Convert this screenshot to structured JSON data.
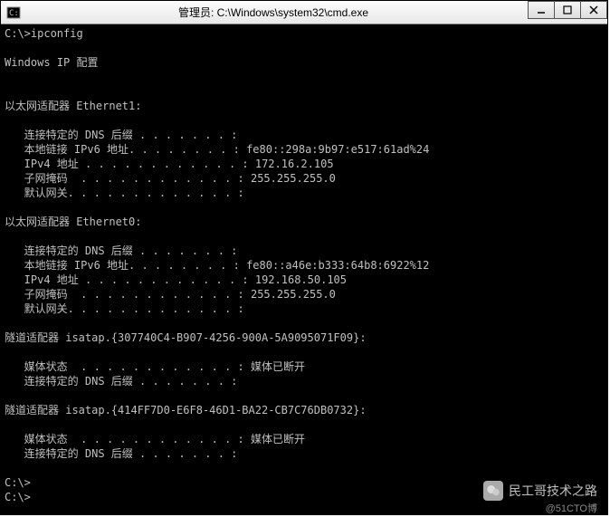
{
  "window": {
    "title": "管理员: C:\\Windows\\system32\\cmd.exe"
  },
  "prompt": "C:\\>",
  "command": "ipconfig",
  "header": "Windows IP 配置",
  "adapters": [
    {
      "title": "以太网适配器 Ethernet1:",
      "rows": [
        {
          "label": "连接特定的 DNS 后缀",
          "dots": " . . . . . . . ",
          "value": ""
        },
        {
          "label": "本地链接 IPv6 地址",
          "dots": ". . . . . . . . ",
          "value": "fe80::298a:9b97:e517:61ad%24"
        },
        {
          "label": "IPv4 地址",
          "dots": " . . . . . . . . . . . . ",
          "value": "172.16.2.105"
        },
        {
          "label": "子网掩码",
          "dots": "  . . . . . . . . . . . . ",
          "value": "255.255.255.0"
        },
        {
          "label": "默认网关",
          "dots": ". . . . . . . . . . . . . ",
          "value": ""
        }
      ]
    },
    {
      "title": "以太网适配器 Ethernet0:",
      "rows": [
        {
          "label": "连接特定的 DNS 后缀",
          "dots": " . . . . . . . ",
          "value": ""
        },
        {
          "label": "本地链接 IPv6 地址",
          "dots": ". . . . . . . . ",
          "value": "fe80::a46e:b333:64b8:6922%12"
        },
        {
          "label": "IPv4 地址",
          "dots": " . . . . . . . . . . . . ",
          "value": "192.168.50.105"
        },
        {
          "label": "子网掩码",
          "dots": "  . . . . . . . . . . . . ",
          "value": "255.255.255.0"
        },
        {
          "label": "默认网关",
          "dots": ". . . . . . . . . . . . . ",
          "value": ""
        }
      ]
    },
    {
      "title": "隧道适配器 isatap.{307740C4-B907-4256-900A-5A9095071F09}:",
      "rows": [
        {
          "label": "媒体状态",
          "dots": "  . . . . . . . . . . . . ",
          "value": "媒体已断开"
        },
        {
          "label": "连接特定的 DNS 后缀",
          "dots": " . . . . . . . ",
          "value": ""
        }
      ]
    },
    {
      "title": "隧道适配器 isatap.{414FF7D0-E6F8-46D1-BA22-CB7C76DB0732}:",
      "rows": [
        {
          "label": "媒体状态",
          "dots": "  . . . . . . . . . . . . ",
          "value": "媒体已断开"
        },
        {
          "label": "连接特定的 DNS 后缀",
          "dots": " . . . . . . . ",
          "value": ""
        }
      ]
    }
  ],
  "trailing_prompts": [
    "C:\\>",
    "C:\\>"
  ],
  "watermark": {
    "main": "民工哥技术之路",
    "sub": "@51CTO博"
  }
}
